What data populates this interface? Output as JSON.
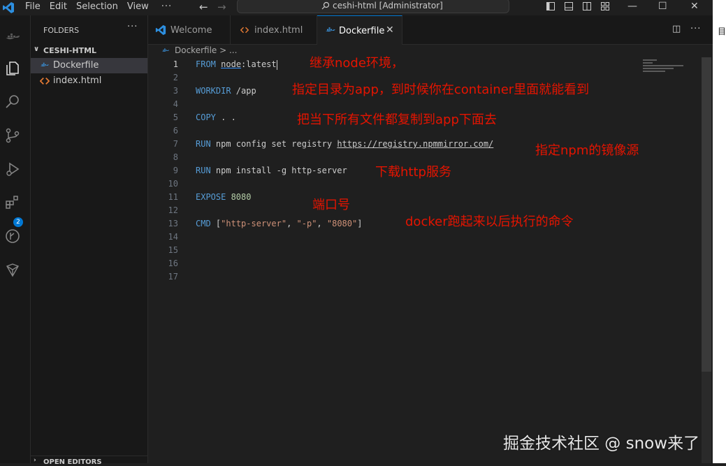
{
  "titlebar": {
    "menu": [
      "File",
      "Edit",
      "Selection",
      "View"
    ],
    "more": "···",
    "command_center": "ceshi-html [Administrator]"
  },
  "activity_badge": "2",
  "sidebar": {
    "title": "FOLDERS",
    "more": "···",
    "folder": "CESHI-HTML",
    "files": [
      {
        "name": "Dockerfile",
        "icon": "docker-icon",
        "active": true
      },
      {
        "name": "index.html",
        "icon": "html-icon",
        "active": false
      }
    ],
    "open_editors": "OPEN EDITORS"
  },
  "tabs": [
    {
      "label": "Welcome",
      "icon": "vscode-icon"
    },
    {
      "label": "index.html",
      "icon": "html-icon"
    },
    {
      "label": "Dockerfile",
      "icon": "docker-icon",
      "active": true
    }
  ],
  "breadcrumb": "Dockerfile > ...",
  "editor": {
    "current_line": 1,
    "line_numbers": [
      "1",
      "2",
      "3",
      "4",
      "5",
      "6",
      "7",
      "8",
      "9",
      "10",
      "11",
      "12",
      "13",
      "14",
      "15",
      "16",
      "17"
    ],
    "code": {
      "l1_kw": "FROM",
      "l1_image": "node",
      "l1_rest": ":latest",
      "l3_kw": "WORKDIR",
      "l3_rest": " /app",
      "l5_kw": "COPY",
      "l5_rest": " . .",
      "l7_kw": "RUN",
      "l7_rest": " npm config set registry ",
      "l7_url": "https://registry.npmmirror.com/",
      "l9_kw": "RUN",
      "l9_rest": " npm install -g http-server",
      "l11_kw": "EXPOSE",
      "l11_num": " 8080",
      "l13_kw": "CMD",
      "l13_p1": " [",
      "l13_s1": "\"http-server\"",
      "l13_c1": ", ",
      "l13_s2": "\"-p\"",
      "l13_c2": ", ",
      "l13_s3": "\"8080\"",
      "l13_p2": "]"
    }
  },
  "annotations": {
    "a1": "继承node环境，",
    "a2": "指定目录为app，到时候你在container里面就能看到",
    "a3": "把当下所有文件都复制到app下面去",
    "a4": "指定npm的镜像源",
    "a5": "下载http服务",
    "a6": "端口号",
    "a7": "docker跑起来以后执行的命令"
  },
  "right_pane_char": "目",
  "watermark": "掘金技术社区 @ snow来了",
  "colors": {
    "accent": "#0078d4",
    "annotation": "#e51400",
    "keyword": "#569cd6",
    "string": "#ce9178",
    "number": "#b5cea8"
  }
}
